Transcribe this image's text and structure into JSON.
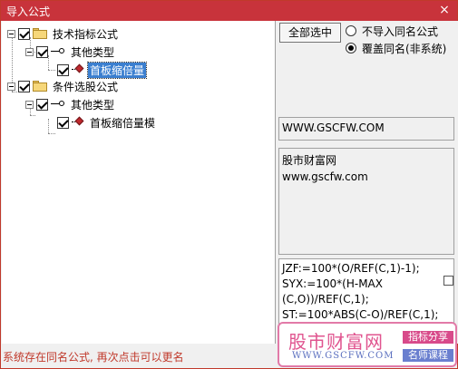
{
  "window": {
    "title": "导入公式",
    "close_icon": "×"
  },
  "tree": {
    "nodes": [
      {
        "label": "技术指标公式"
      },
      {
        "label": "其他类型"
      },
      {
        "label": "首板缩倍量"
      },
      {
        "label": "条件选股公式"
      },
      {
        "label": "其他类型"
      },
      {
        "label": "首板缩倍量模"
      }
    ]
  },
  "panel": {
    "select_all_label": "全部选中",
    "radio_skip_label": "不导入同名公式",
    "radio_overwrite_label": "覆盖同名(非系统)",
    "url_text": "WWW.GSCFW.COM",
    "description_lines": [
      "股市财富网",
      "www.gscfw.com"
    ],
    "code_lines": [
      "JZF:=100*(O/REF(C,1)-1);",
      "SYX:=100*(H-MAX",
      "(C,O))/REF(C,1);",
      "ST:=100*ABS(C-O)/REF(C,1);"
    ]
  },
  "status": {
    "text": "系统存在同名公式, 再次点击可以更名"
  },
  "watermark": {
    "title": "股市财富网",
    "url": "WWW.GSCFW.COM",
    "tag_a": "指标分享",
    "tag_b": "名师课程"
  },
  "colors": {
    "titlebar": "#c8333b",
    "selection": "#3b7fd0",
    "status": "#c0392b",
    "watermark_border": "#e27aa8"
  }
}
